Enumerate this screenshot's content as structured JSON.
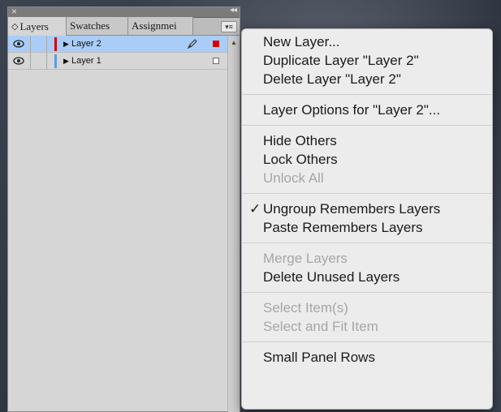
{
  "panel": {
    "tabs": [
      {
        "label": "Layers",
        "active": true
      },
      {
        "label": "Swatches",
        "active": false
      },
      {
        "label": "Assignmei",
        "active": false
      }
    ],
    "layers": [
      {
        "name": "Layer 2",
        "color": "#d40000",
        "selected": true
      },
      {
        "name": "Layer 1",
        "color": "#5a9be6",
        "selected": false
      }
    ]
  },
  "menu": {
    "groups": [
      [
        {
          "label": "New Layer...",
          "enabled": true
        },
        {
          "label": "Duplicate Layer \"Layer 2\"",
          "enabled": true
        },
        {
          "label": "Delete Layer \"Layer 2\"",
          "enabled": true
        }
      ],
      [
        {
          "label": "Layer Options for \"Layer 2\"...",
          "enabled": true
        }
      ],
      [
        {
          "label": "Hide Others",
          "enabled": true
        },
        {
          "label": "Lock Others",
          "enabled": true
        },
        {
          "label": "Unlock All",
          "enabled": false
        }
      ],
      [
        {
          "label": "Ungroup Remembers Layers",
          "enabled": true,
          "checked": true
        },
        {
          "label": "Paste Remembers Layers",
          "enabled": true
        }
      ],
      [
        {
          "label": "Merge Layers",
          "enabled": false
        },
        {
          "label": "Delete Unused Layers",
          "enabled": true
        }
      ],
      [
        {
          "label": "Select Item(s)",
          "enabled": false
        },
        {
          "label": "Select and Fit Item",
          "enabled": false
        }
      ],
      [
        {
          "label": "Small Panel Rows",
          "enabled": true
        }
      ]
    ]
  }
}
